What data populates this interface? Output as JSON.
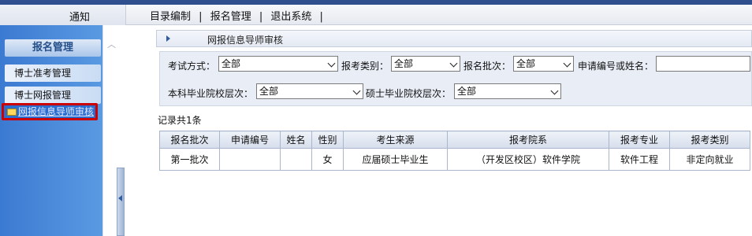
{
  "header": {
    "notice": "通知",
    "nav": [
      "目录编制",
      "报名管理",
      "退出系统"
    ],
    "separator": "|"
  },
  "sidebar": {
    "title": "报名管理",
    "items": [
      {
        "label": "博士准考管理"
      },
      {
        "label": "博士网报管理"
      },
      {
        "label": "网报信息导师审核",
        "active": true
      }
    ]
  },
  "breadcrumb": "网报信息导师审核",
  "filters": {
    "exam_mode_label": "考试方式：",
    "exam_mode_value": "全部",
    "apply_type_label": "报考类别：",
    "apply_type_value": "全部",
    "batch_label": "报名批次：",
    "batch_value": "全部",
    "id_or_name_label": "申请编号或姓名：",
    "id_or_name_value": "",
    "bachelor_level_label": "本科毕业院校层次：",
    "bachelor_level_value": "全部",
    "master_level_label": "硕士毕业院校层次：",
    "master_level_value": "全部"
  },
  "record_count": "记录共1条",
  "table": {
    "headers": [
      "报名批次",
      "申请编号",
      "姓名",
      "性别",
      "考生来源",
      "报考院系",
      "报考专业",
      "报考类别"
    ],
    "rows": [
      [
        "第一批次",
        "",
        "",
        "女",
        "应届硕士毕业生",
        "（开发区校区）软件学院",
        "软件工程",
        "非定向就业"
      ]
    ]
  },
  "colors": {
    "sidebar_blue": "#3b7ad1",
    "active_border": "#cc0000"
  }
}
